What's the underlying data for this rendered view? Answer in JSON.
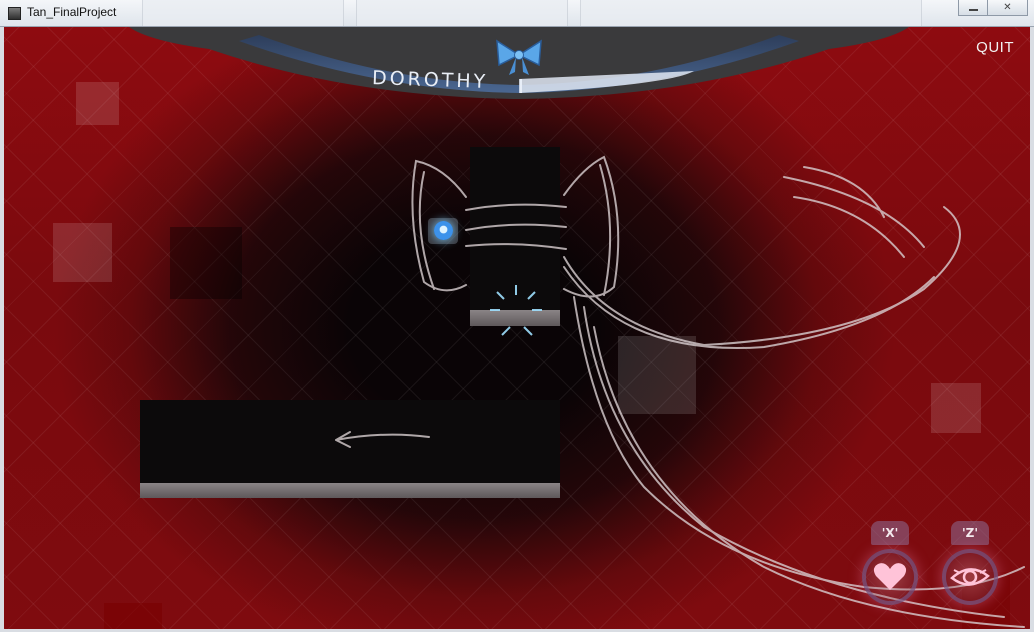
{
  "window": {
    "title": "Tan_FinalProject",
    "minimize_icon": "minimize-icon",
    "close_icon": "close-icon"
  },
  "hud": {
    "character_name": "DOROTHY",
    "quit_label": "QUIT",
    "bow_icon": "bow-icon"
  },
  "abilities": [
    {
      "key": "'X'",
      "icon": "heart-icon",
      "name": "heart"
    },
    {
      "key": "'Z'",
      "icon": "eye-icon",
      "name": "eye"
    }
  ],
  "colors": {
    "background_red": "#8e0b10",
    "accent_blue": "#4a78b8",
    "orb_blue": "#3d92ea",
    "ability_pink": "#ffc3d8"
  }
}
